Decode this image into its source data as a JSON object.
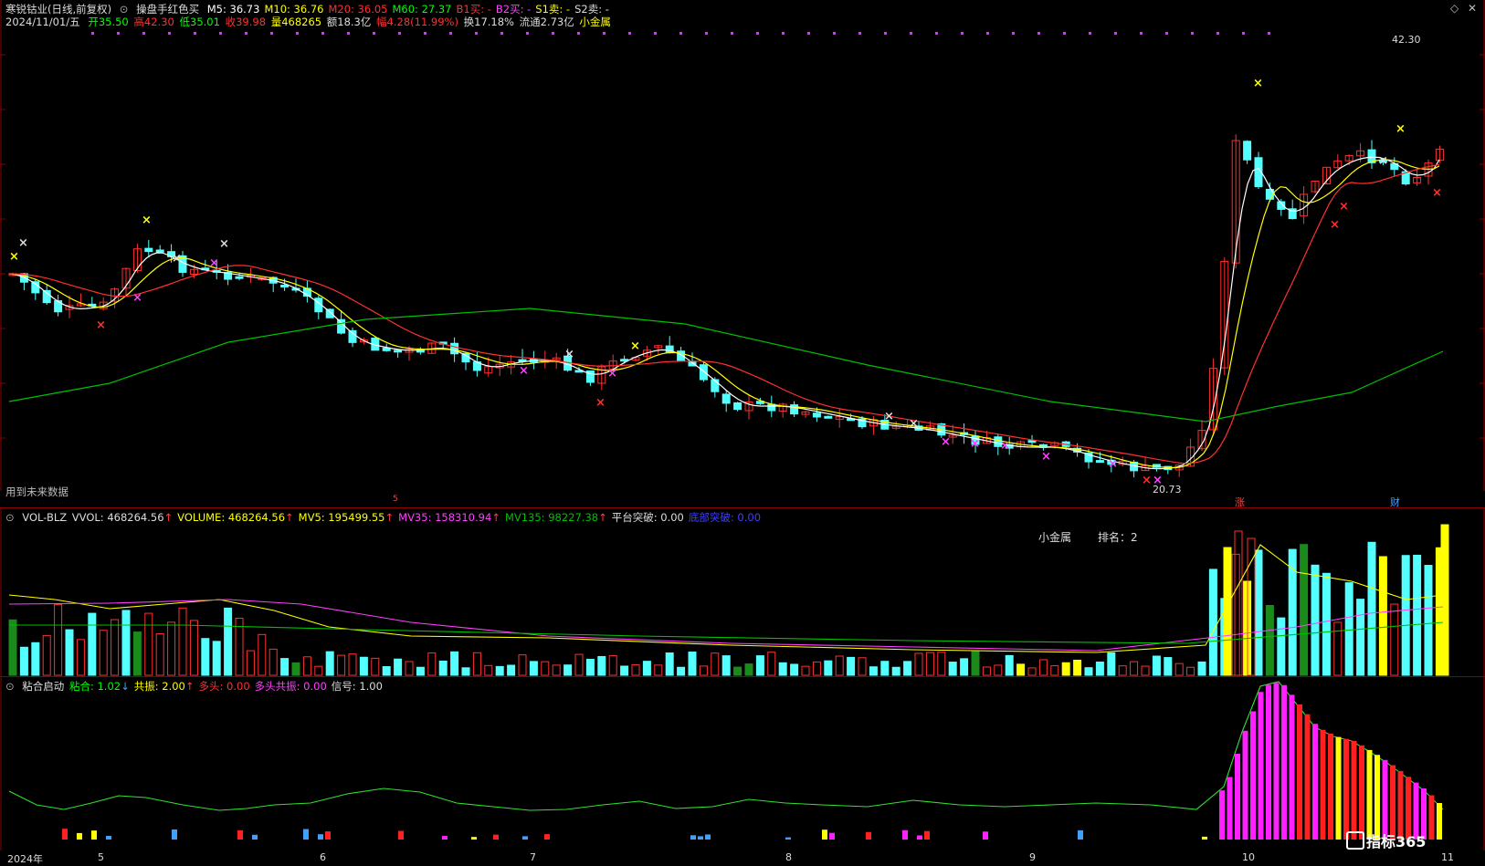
{
  "main": {
    "stock_name": "寒锐钴业(日线,前复权)",
    "formula": "操盘手红色买",
    "ma": [
      {
        "label": "M5: 36.73",
        "color": "#ffffff"
      },
      {
        "label": "M10: 36.76",
        "color": "#ffff00"
      },
      {
        "label": "M20: 36.05",
        "color": "#ff3030"
      },
      {
        "label": "M60: 27.37",
        "color": "#00ff00"
      },
      {
        "label": "B1买: -",
        "color": "#ff3030"
      },
      {
        "label": "B2买: -",
        "color": "#ff40ff"
      },
      {
        "label": "S1卖: -",
        "color": "#ffff00"
      },
      {
        "label": "S2卖: -",
        "color": "#dddddd"
      }
    ],
    "quote": {
      "date": "2024/11/01/五",
      "open": "开35.50",
      "high": "高42.30",
      "low": "低35.01",
      "close": "收39.98",
      "vol": "量468265",
      "amount": "额18.3亿",
      "change": "幅4.28(11.99%)",
      "turnover": "换17.18%",
      "float": "流通2.73亿",
      "sector": "小金属"
    },
    "high_label": "42.30",
    "low_label": "20.73",
    "future_note": "用到未来数据",
    "markers": [
      {
        "text": "涨",
        "color": "#ff4040"
      },
      {
        "text": "财",
        "color": "#40a0ff"
      },
      {
        "text": "5",
        "color": "#ff4040"
      }
    ]
  },
  "volume": {
    "name": "VOL-BLZ",
    "items": [
      {
        "label": "VVOL: 468264.56",
        "color": "#dddddd",
        "arrow": "up"
      },
      {
        "label": "VOLUME: 468264.56",
        "color": "#ffff00",
        "arrow": "up"
      },
      {
        "label": "MV5: 195499.55",
        "color": "#ffff00",
        "arrow": "up"
      },
      {
        "label": "MV35: 158310.94",
        "color": "#ff40ff",
        "arrow": "up"
      },
      {
        "label": "MV135: 98227.38",
        "color": "#00c000",
        "arrow": "up"
      },
      {
        "label": "平台突破: 0.00",
        "color": "#dddddd",
        "arrow": ""
      },
      {
        "label": "底部突破: 0.00",
        "color": "#4040ff",
        "arrow": ""
      }
    ],
    "rank_label": "小金属",
    "rank_text": "排名：2"
  },
  "indicator": {
    "name": "粘合启动",
    "items": [
      {
        "label": "粘合: 1.02",
        "color": "#00ff00",
        "arrow": "dn"
      },
      {
        "label": "共振: 2.00",
        "color": "#ffff00",
        "arrow": "up"
      },
      {
        "label": "多头: 0.00",
        "color": "#ff3030",
        "arrow": ""
      },
      {
        "label": "多头共振: 0.00",
        "color": "#ff40ff",
        "arrow": ""
      },
      {
        "label": "信号: 1.00",
        "color": "#dddddd",
        "arrow": ""
      }
    ]
  },
  "axis": {
    "months": [
      "2024年",
      "5",
      "6",
      "7",
      "8",
      "9",
      "10",
      "11"
    ]
  },
  "watermark": "指标365",
  "colors": {
    "up": "#ff3030",
    "down": "#54ffff",
    "ma5": "#ffffff",
    "ma10": "#ffff00",
    "ma20": "#ff3030",
    "ma60": "#00c000"
  }
}
